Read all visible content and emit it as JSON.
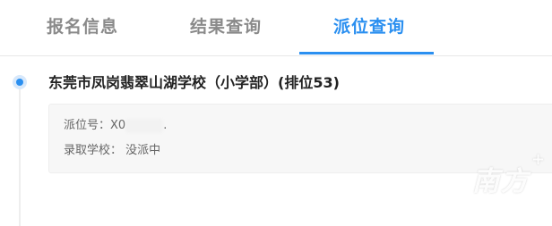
{
  "tabs": [
    {
      "label": "报名信息"
    },
    {
      "label": "结果查询"
    },
    {
      "label": "派位查询"
    }
  ],
  "active_tab": 2,
  "result": {
    "school_title": "东莞市凤岗翡翠山湖学校（小学部）(排位53)",
    "number_label": "派位号：X0",
    "number_tail": ".",
    "admission_label": "录取学校：",
    "admission_value": "没派中"
  },
  "watermark": {
    "text": "南方",
    "plus": "+"
  },
  "colors": {
    "accent": "#2a8ff0",
    "tab_inactive": "#8a8a8a",
    "card_bg": "#f7f7f7"
  }
}
